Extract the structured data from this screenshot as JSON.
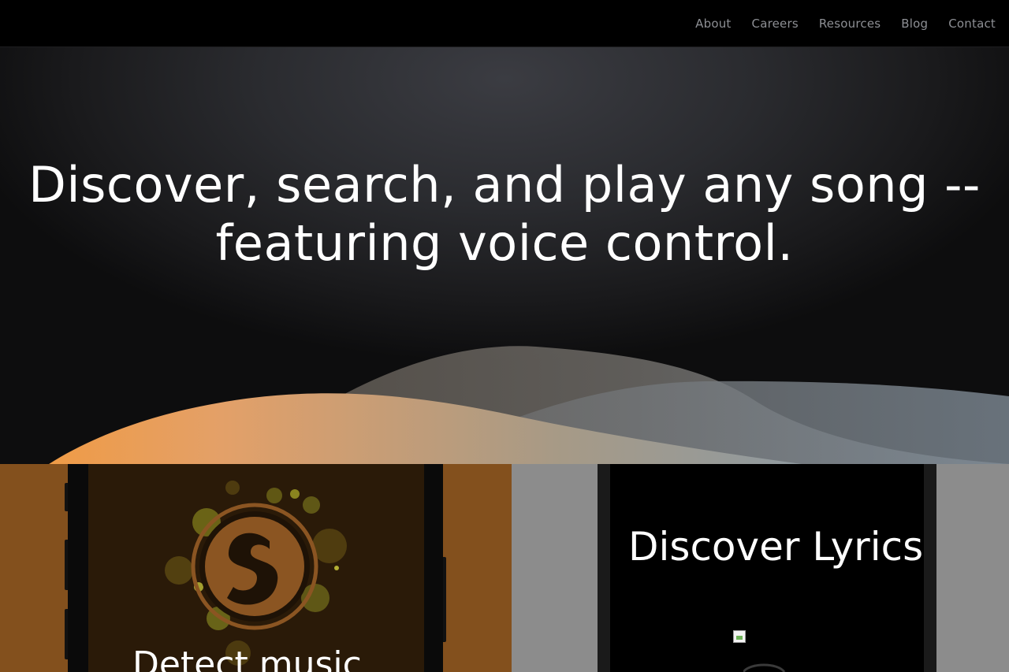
{
  "nav": {
    "items": [
      {
        "label": "About"
      },
      {
        "label": "Careers"
      },
      {
        "label": "Resources"
      },
      {
        "label": "Blog"
      },
      {
        "label": "Contact"
      }
    ]
  },
  "hero": {
    "title_line1": "Discover, search, and play any song --",
    "title_line2": "featuring voice control."
  },
  "panels": {
    "left": {
      "heading": "Detect music"
    },
    "right": {
      "heading": "Discover Lyrics"
    }
  },
  "colors": {
    "nav_bg": "#000000",
    "nav_text": "#8d8f94",
    "wave_orange": "#f39a3d",
    "wave_blue": "#6f93b8",
    "left_panel": "#83501d",
    "right_panel": "#8c8c8c"
  },
  "icons": {
    "app_logo": "soundhound-s-logo",
    "broken_image": "broken-image-icon"
  }
}
